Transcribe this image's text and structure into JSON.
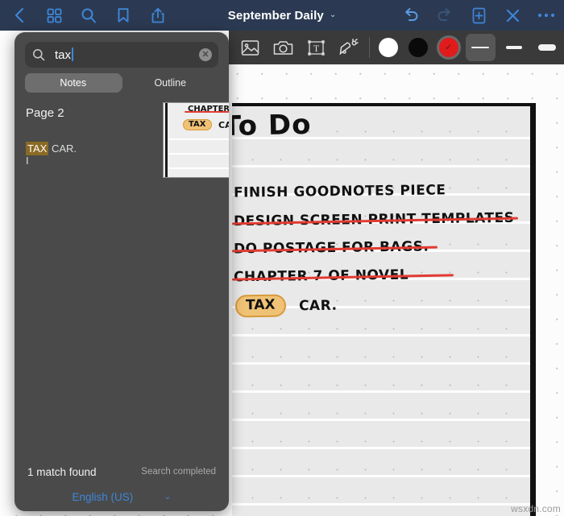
{
  "top_bar": {
    "left_icons": [
      {
        "name": "back-icon",
        "label": "Back"
      },
      {
        "name": "grid-icon",
        "label": "Thumbnails"
      },
      {
        "name": "search-icon",
        "label": "Search"
      },
      {
        "name": "bookmark-icon",
        "label": "Bookmark"
      },
      {
        "name": "share-icon",
        "label": "Share"
      }
    ],
    "title": "September Daily",
    "title_chevron": "⌄",
    "right_icons": [
      {
        "name": "undo-icon",
        "label": "Undo"
      },
      {
        "name": "redo-icon",
        "label": "Redo"
      },
      {
        "name": "add-page-icon",
        "label": "Add Page"
      },
      {
        "name": "close-icon",
        "label": "Close"
      },
      {
        "name": "more-icon",
        "label": "More"
      }
    ],
    "background": "#2b3a52",
    "icon_color": "#3f86d8"
  },
  "tool_bar": {
    "tools": [
      {
        "name": "image-icon",
        "label": "Insert Image"
      },
      {
        "name": "camera-icon",
        "label": "Camera"
      },
      {
        "name": "text-box-icon",
        "label": "Text Box"
      },
      {
        "name": "sticker-wand-icon",
        "label": "Sticker"
      }
    ],
    "colors": [
      {
        "name": "color-white",
        "hex": "#ffffff",
        "selected": false
      },
      {
        "name": "color-black",
        "hex": "#0a0a0a",
        "selected": false
      },
      {
        "name": "color-red",
        "hex": "#e11b1b",
        "selected": true
      }
    ],
    "stroke_widths": [
      {
        "name": "stroke-thin",
        "px": 2,
        "selected": true
      },
      {
        "name": "stroke-medium",
        "px": 3,
        "selected": false
      },
      {
        "name": "stroke-thick",
        "px": 7,
        "selected": false
      }
    ],
    "background": "#3a3a3a"
  },
  "search_panel": {
    "query": "tax",
    "placeholder": "Search",
    "clear_label": "✕",
    "tabs": [
      {
        "name": "tab-notes",
        "label": "Notes",
        "selected": true
      },
      {
        "name": "tab-outline",
        "label": "Outline",
        "selected": false
      }
    ],
    "results": [
      {
        "page_label": "Page 2",
        "highlight": "TAX",
        "snippet_rest": " CAR.",
        "snippet_line2": "I"
      }
    ],
    "match_count": "1 match found",
    "search_state": "Search completed",
    "language": "English (US)",
    "language_chevron": "⌄",
    "accent": "#3f86d8",
    "highlight_color": "#8a6a24",
    "background": "#4a4a4a"
  },
  "note_page": {
    "title": "To Do",
    "lines": [
      {
        "text": "FINISH  GOODNOTES  PIECE",
        "struck": false
      },
      {
        "text": "DESIGN  SCREEN PRINT  TEMPLATES",
        "struck": true
      },
      {
        "text": "DO POSTAGE FOR BAGS.",
        "struck": true
      },
      {
        "text": "CHAPTER  7  OF NOVEL",
        "struck": true
      }
    ],
    "highlighted_item": {
      "pill_text": "TAX",
      "rest": "CAR."
    },
    "ink_color": "#111111",
    "strike_color": "#e23b32",
    "highlight_fill": "#f0c276"
  },
  "thumbnail": {
    "strike_text": "CHAPTER",
    "pill_text": "TAX",
    "rest_text": "CA"
  },
  "watermark": "wsxdn.com"
}
